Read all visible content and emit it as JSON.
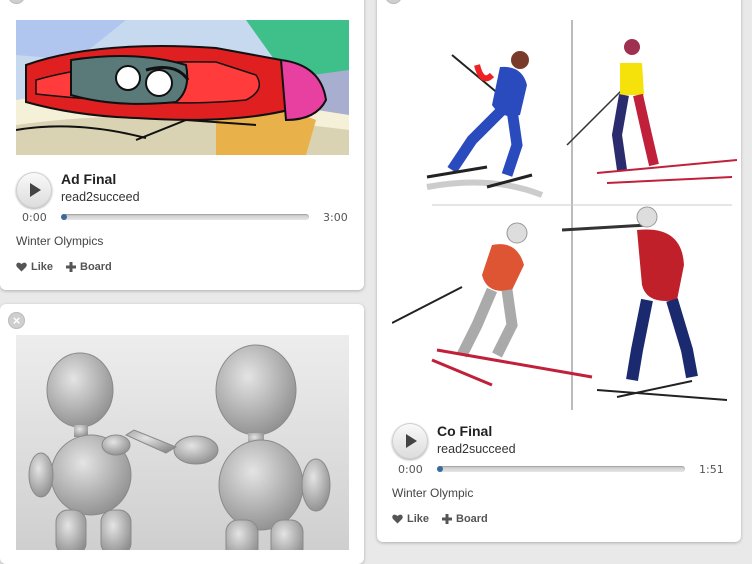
{
  "cards": [
    {
      "title": "Ad Final",
      "author": "read2succeed",
      "time_current": "0:00",
      "time_total": "3:00",
      "progress": 0,
      "description": "Winter Olympics",
      "like_label": "Like",
      "board_label": "Board"
    },
    {
      "title": "Co Final",
      "author": "read2succeed",
      "time_current": "0:00",
      "time_total": "1:51",
      "progress": 0,
      "description": "Winter Olympic",
      "like_label": "Like",
      "board_label": "Board"
    },
    {}
  ],
  "icons": {
    "close": "close-icon",
    "play": "play-icon",
    "like": "heart-icon",
    "board": "plus-icon"
  },
  "colors": {
    "progress_knob": "#3a6a9a",
    "background": "#e9e9e9"
  }
}
